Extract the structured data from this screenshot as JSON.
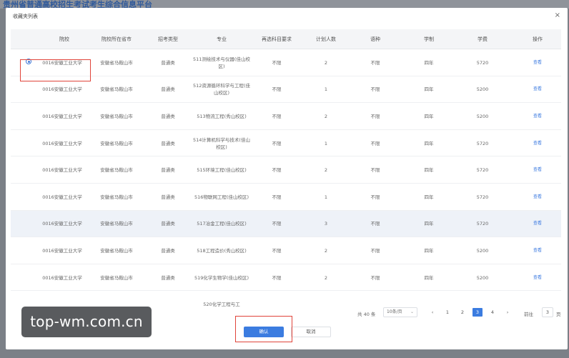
{
  "background": {
    "page_title": "贵州省普通高校招生考试考生综合信息平台"
  },
  "modal": {
    "title": "收藏夹列表",
    "close_icon": "×"
  },
  "table": {
    "columns": [
      "院校",
      "院校所在省市",
      "招考类型",
      "专业",
      "再选科目要求",
      "计划人数",
      "语种",
      "学制",
      "学费",
      "操作"
    ],
    "rows": [
      {
        "school": "0016安徽工业大学",
        "city": "安徽省马鞍山市",
        "type": "普通类",
        "major": "511测绘技术与仪器(佳山校区)",
        "req": "不限",
        "plan": "2",
        "lang": "不限",
        "years": "四年",
        "fee": "5720",
        "action": "查看"
      },
      {
        "school": "0016安徽工业大学",
        "city": "安徽省马鞍山市",
        "type": "普通类",
        "major": "512资源循环科学与工程(佳山校区)",
        "req": "不限",
        "plan": "1",
        "lang": "不限",
        "years": "四年",
        "fee": "5200",
        "action": "查看"
      },
      {
        "school": "0016安徽工业大学",
        "city": "安徽省马鞍山市",
        "type": "普通类",
        "major": "513物流工程(秀山校区)",
        "req": "不限",
        "plan": "2",
        "lang": "不限",
        "years": "四年",
        "fee": "5200",
        "action": "查看"
      },
      {
        "school": "0016安徽工业大学",
        "city": "安徽省马鞍山市",
        "type": "普通类",
        "major": "514计算机科学与技术(佳山校区)",
        "req": "不限",
        "plan": "1",
        "lang": "不限",
        "years": "四年",
        "fee": "5720",
        "action": "查看"
      },
      {
        "school": "0016安徽工业大学",
        "city": "安徽省马鞍山市",
        "type": "普通类",
        "major": "515环境工程(佳山校区)",
        "req": "不限",
        "plan": "2",
        "lang": "不限",
        "years": "四年",
        "fee": "5720",
        "action": "查看"
      },
      {
        "school": "0016安徽工业大学",
        "city": "安徽省马鞍山市",
        "type": "普通类",
        "major": "516物联网工程(佳山校区)",
        "req": "不限",
        "plan": "1",
        "lang": "不限",
        "years": "四年",
        "fee": "5720",
        "action": "查看"
      },
      {
        "school": "0016安徽工业大学",
        "city": "安徽省马鞍山市",
        "type": "普通类",
        "major": "517冶金工程(佳山校区)",
        "req": "不限",
        "plan": "3",
        "lang": "不限",
        "years": "四年",
        "fee": "5720",
        "action": "查看"
      },
      {
        "school": "0016安徽工业大学",
        "city": "安徽省马鞍山市",
        "type": "普通类",
        "major": "518工程造价(秀山校区)",
        "req": "不限",
        "plan": "2",
        "lang": "不限",
        "years": "四年",
        "fee": "5200",
        "action": "查看"
      },
      {
        "school": "0016安徽工业大学",
        "city": "安徽省马鞍山市",
        "type": "普通类",
        "major": "519化学生物学(佳山校区)",
        "req": "不限",
        "plan": "2",
        "lang": "不限",
        "years": "四年",
        "fee": "5200",
        "action": "查看"
      },
      {
        "school": "",
        "city": "",
        "type": "",
        "major": "520化学工程与工",
        "req": "",
        "plan": "",
        "lang": "",
        "years": "",
        "fee": "",
        "action": ""
      }
    ],
    "selected_row": 0,
    "highlighted_row": 6
  },
  "pagination": {
    "total": "共 40 条",
    "page_size": "10条/页",
    "prev_icon": "‹",
    "next_icon": "›",
    "pages": [
      "1",
      "2",
      "3",
      "4"
    ],
    "current_page": 3,
    "goto_label": "前往",
    "goto_value": "3",
    "page_suffix": "页"
  },
  "footer": {
    "confirm_label": "确认",
    "cancel_label": "取消"
  },
  "watermark": {
    "text": "top-wm.com.cn"
  },
  "colors": {
    "accent": "#3b7ce0",
    "highlight_box": "#e0443a",
    "row_highlight": "#eef2f8"
  }
}
